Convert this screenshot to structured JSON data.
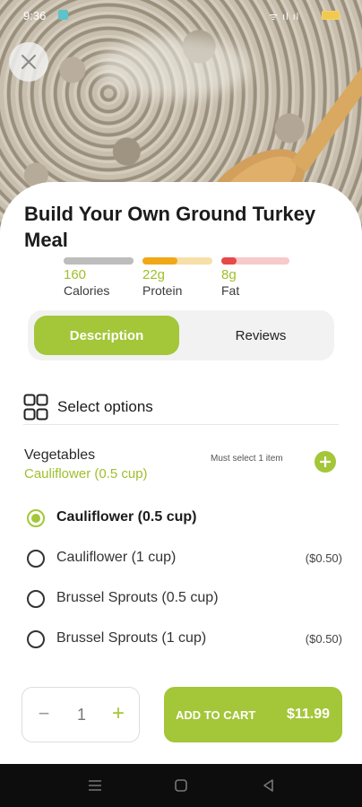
{
  "status_bar": {
    "time": "9:36",
    "signal": "ᯤ ıl ıl"
  },
  "product": {
    "title": "Build Your Own Ground Turkey Meal"
  },
  "macros": [
    {
      "value": "160",
      "label": "Calories",
      "fill_fraction": 1.0,
      "track_color": "#bdbdbd",
      "fill_color": "#bdbdbd"
    },
    {
      "value": "22g",
      "label": "Protein",
      "fill_fraction": 0.5,
      "track_color": "#f6dfa8",
      "fill_color": "#f0a818"
    },
    {
      "value": "8g",
      "label": "Fat",
      "fill_fraction": 0.22,
      "track_color": "#f7c9c9",
      "fill_color": "#e84848"
    }
  ],
  "tabs": {
    "description": "Description",
    "reviews": "Reviews",
    "active": "description"
  },
  "options_section": {
    "title": "Select options",
    "group": {
      "name": "Vegetables",
      "selected_summary": "Cauliflower (0.5 cup)",
      "requirement": "Must select 1 item",
      "options": [
        {
          "name": "Cauliflower (0.5 cup)",
          "price": "",
          "selected": true
        },
        {
          "name": "Cauliflower (1 cup)",
          "price": "($0.50)",
          "selected": false
        },
        {
          "name": "Brussel Sprouts (0.5 cup)",
          "price": "",
          "selected": false
        },
        {
          "name": "Brussel Sprouts (1 cup)",
          "price": "($0.50)",
          "selected": false
        }
      ]
    }
  },
  "cart": {
    "quantity": "1",
    "minus": "−",
    "plus": "+",
    "button_label": "ADD TO CART",
    "total": "$11.99"
  },
  "colors": {
    "accent": "#a4c639",
    "accent_text": "#9fbf2c"
  },
  "icons": {
    "close": "close-icon",
    "options": "grid-options-icon",
    "add": "plus-icon"
  }
}
